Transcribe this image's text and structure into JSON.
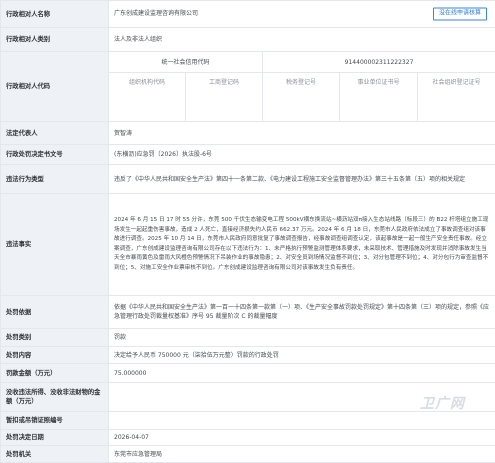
{
  "rows": {
    "party_name": {
      "label": "行政相对人名称",
      "value": "广东创成建设监理咨询有限公司",
      "claim_button": "没在线申请核算"
    },
    "party_category": {
      "label": "行政相对人类别",
      "value": "法人及非法人组织"
    },
    "party_code": {
      "label": "行政相对人代码",
      "uscc_header": "统一社会信用代码",
      "uscc_value": "914400002311222327",
      "sub_headers": [
        "组织机构代码",
        "工商登记码",
        "税务登记号",
        "事业单位证书号",
        "社会组织登记证号"
      ]
    },
    "legal_rep": {
      "label": "法定代表人",
      "value": "贺智涛"
    },
    "doc_no": {
      "label": "行政处罚决定书文号",
      "value": "(东横沥)应急罚〔2026〕执法股-6号"
    },
    "violation_type": {
      "label": "违法行为类型",
      "value": "违反了《中华人民共和国安全生产法》第四十一条第二款、《电力建设工程施工安全监督管理办法》第三十五条第（五）项的相关规定"
    },
    "facts": {
      "label": "违法事实",
      "value": "2024 年 6 月 15 日 17 时 55 分许，东莞 500 千伏生态输变电工程 500kV横东换流站~横沥站双π接入生态站线路（标段三）的 B22 杆塔组立施工现场发生一起起重伤害事故，造成 2 人死亡，直接经济损失约人民币 662.37 万元。2024 年 6 月 18 日，东莞市人民政府依法成立了事故调查组对该事故进行调查。2025 年 10 月 14 日，东莞市人民政府同意批复了事故调查报告，经事故调查组调查认定，该起事故是一起一般生产安全责任事故。经立案调查，广东创成建设监理咨询有限公司存在以下违法行为：1、未严格执行预警监测管理体系要求，未采取技术、管理措施及时发现并消除事故发生当天全市暴雨黄色及雷雨大风橙色预警情况下吊装作业的事故隐患；2、对安全员到场情况监督不到位；3、对分包管理不到位；4、对分包行为审查监督不到位；5、对施工安全作业票审核不到位。广东创成建设监理咨询有限公司对该事故发生负有责任。"
    },
    "basis": {
      "label": "处罚依据",
      "value": "依据《中华人民共和国安全生产法》第一百一十四条第一款第（一）项、《生产安全事故罚款处罚规定》第十四条第（三）项的规定，参照《应急管理行政处罚裁量权基准》序号 95 裁量阶次 C 的裁量幅度"
    },
    "category": {
      "label": "处罚类别",
      "value": "罚款"
    },
    "content": {
      "label": "处罚内容",
      "value": "决定给予人民币 750000 元（柒拾伍万元整）罚款的行政处罚"
    },
    "fine": {
      "label": "罚款金额（万元）",
      "value": "75.000000"
    },
    "confiscation": {
      "label": "没收违法所得、没收非法财物的金额（万元）",
      "value": ""
    },
    "suspend": {
      "label": "暂扣或吊销证照编号",
      "value": ""
    },
    "decision_date": {
      "label": "处罚决定日期",
      "value": "2026-04-07"
    },
    "authority": {
      "label": "处罚机关",
      "value": "东莞市应急管理局"
    }
  },
  "watermark": "卫广网",
  "colors": {
    "label_bg": "#eef2f6",
    "border": "#e4e7ed",
    "accent": "#3a86d8"
  }
}
